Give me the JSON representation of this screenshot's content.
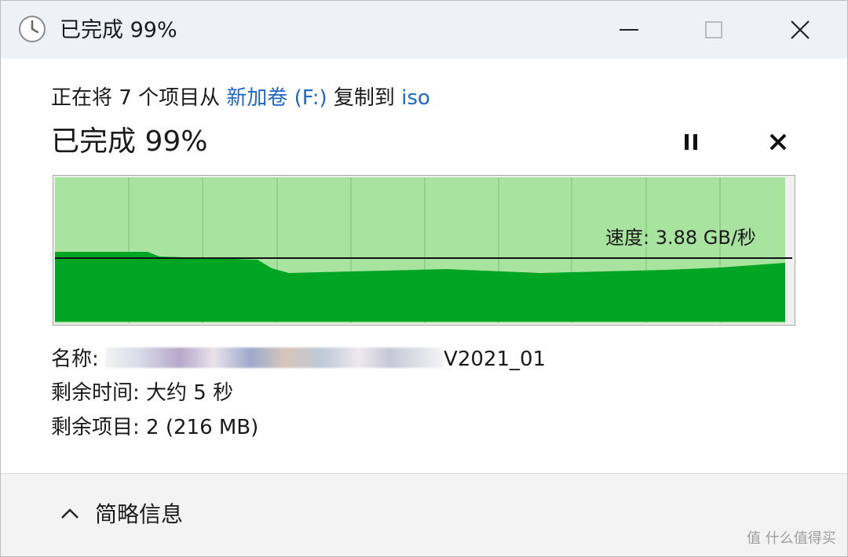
{
  "window": {
    "title": "已完成 99%",
    "icons": [
      "clock-icon",
      "minimize-icon",
      "maximize-icon",
      "close-icon"
    ]
  },
  "copy": {
    "prefix": "正在将 7 个项目从 ",
    "source": "新加卷 (F:)",
    "middle": " 复制到 ",
    "destination": "iso"
  },
  "progress": {
    "label": "已完成 99%",
    "value": 99
  },
  "controls": {
    "pause_icon": "pause-icon",
    "cancel_icon": "close-icon"
  },
  "speed": {
    "text": "速度: 3.88 GB/秒",
    "current_value": 3.88,
    "unit": "GB/秒"
  },
  "details": {
    "name_label": "名称: ",
    "name_visible_suffix": "V2021_01",
    "time_label": "剩余时间: ",
    "time_value": "大约 5 秒",
    "items_label": "剩余项目: ",
    "items_value": "2 (216 MB)"
  },
  "footer": {
    "toggle_label": "简略信息",
    "chevron_icon": "chevron-up-icon"
  },
  "watermark": {
    "text": "值 什么值得买",
    "icon": "watermark-icon"
  },
  "colors": {
    "titlebar": "#eef2f7",
    "graph_background": "#a8e3a0",
    "graph_fill": "#00a524",
    "link": "#1f66c9",
    "footer": "#f3f3f3"
  }
}
